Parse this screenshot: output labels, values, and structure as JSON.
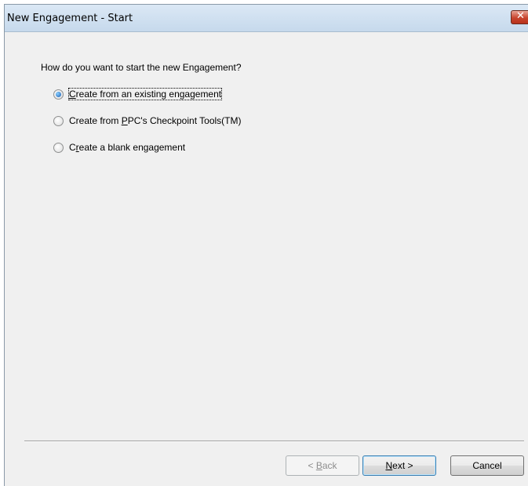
{
  "window": {
    "title": "New Engagement - Start"
  },
  "question": "How do you want to start the new Engagement?",
  "options": [
    {
      "label_pre": "",
      "mnemonic": "C",
      "label_post": "reate from an existing engagement",
      "checked": true
    },
    {
      "label_pre": "Create from ",
      "mnemonic": "P",
      "label_post": "PC's Checkpoint Tools(TM)",
      "checked": false
    },
    {
      "label_pre": "C",
      "mnemonic": "r",
      "label_post": "eate a blank engagement",
      "checked": false
    }
  ],
  "buttons": {
    "back": {
      "pre": "< ",
      "mnemonic": "B",
      "post": "ack",
      "enabled": false
    },
    "next": {
      "pre": "",
      "mnemonic": "N",
      "post": "ext >",
      "enabled": true
    },
    "cancel": {
      "label": "Cancel",
      "enabled": true
    }
  }
}
